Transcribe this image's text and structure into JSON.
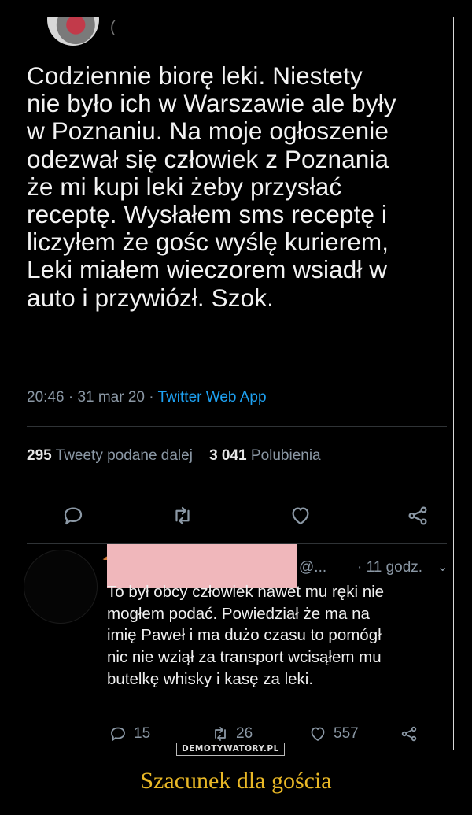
{
  "tweet": {
    "avatar_suffix": "(",
    "text": "Codziennie biorę leki. Niestety\nnie było ich w Warszawie ale były\nw Poznaniu. Na moje ogłoszenie\nodezwał się człowiek z Poznania\nże mi kupi leki żeby przysłać\nreceptę. Wysłałem sms receptę i\nliczyłem że gośc wyślę kurierem,\nLeki miałem wieczorem wsiadł w\nauto i przywiózł. Szok.",
    "time": "20:46",
    "date": "31 mar 20",
    "source": "Twitter Web App",
    "retweets_count": "295",
    "retweets_label": "Tweety podane dalej",
    "likes_count": "3 041",
    "likes_label": "Polubienia"
  },
  "reply": {
    "handle": "@...",
    "time": "· 11 godz.",
    "text": "To był obcy człowiek nawet mu ręki nie\nmogłem podać. Powiedział że ma na\nimię Paweł i ma dużo czasu to pomógł\nnic nie wziął za transport wcisąłem mu\nbutelkę whisky i kasę za leki.",
    "replies": "15",
    "retweets": "26",
    "likes": "557"
  },
  "watermark": "DEMOTYWATORY.PL",
  "caption": "Szacunek dla gościa",
  "icons": [
    "reply-icon",
    "retweet-icon",
    "like-icon",
    "share-icon"
  ],
  "colors": {
    "accent": "#1da1f2",
    "caption": "#e9b826",
    "muted": "#8b98a5"
  }
}
